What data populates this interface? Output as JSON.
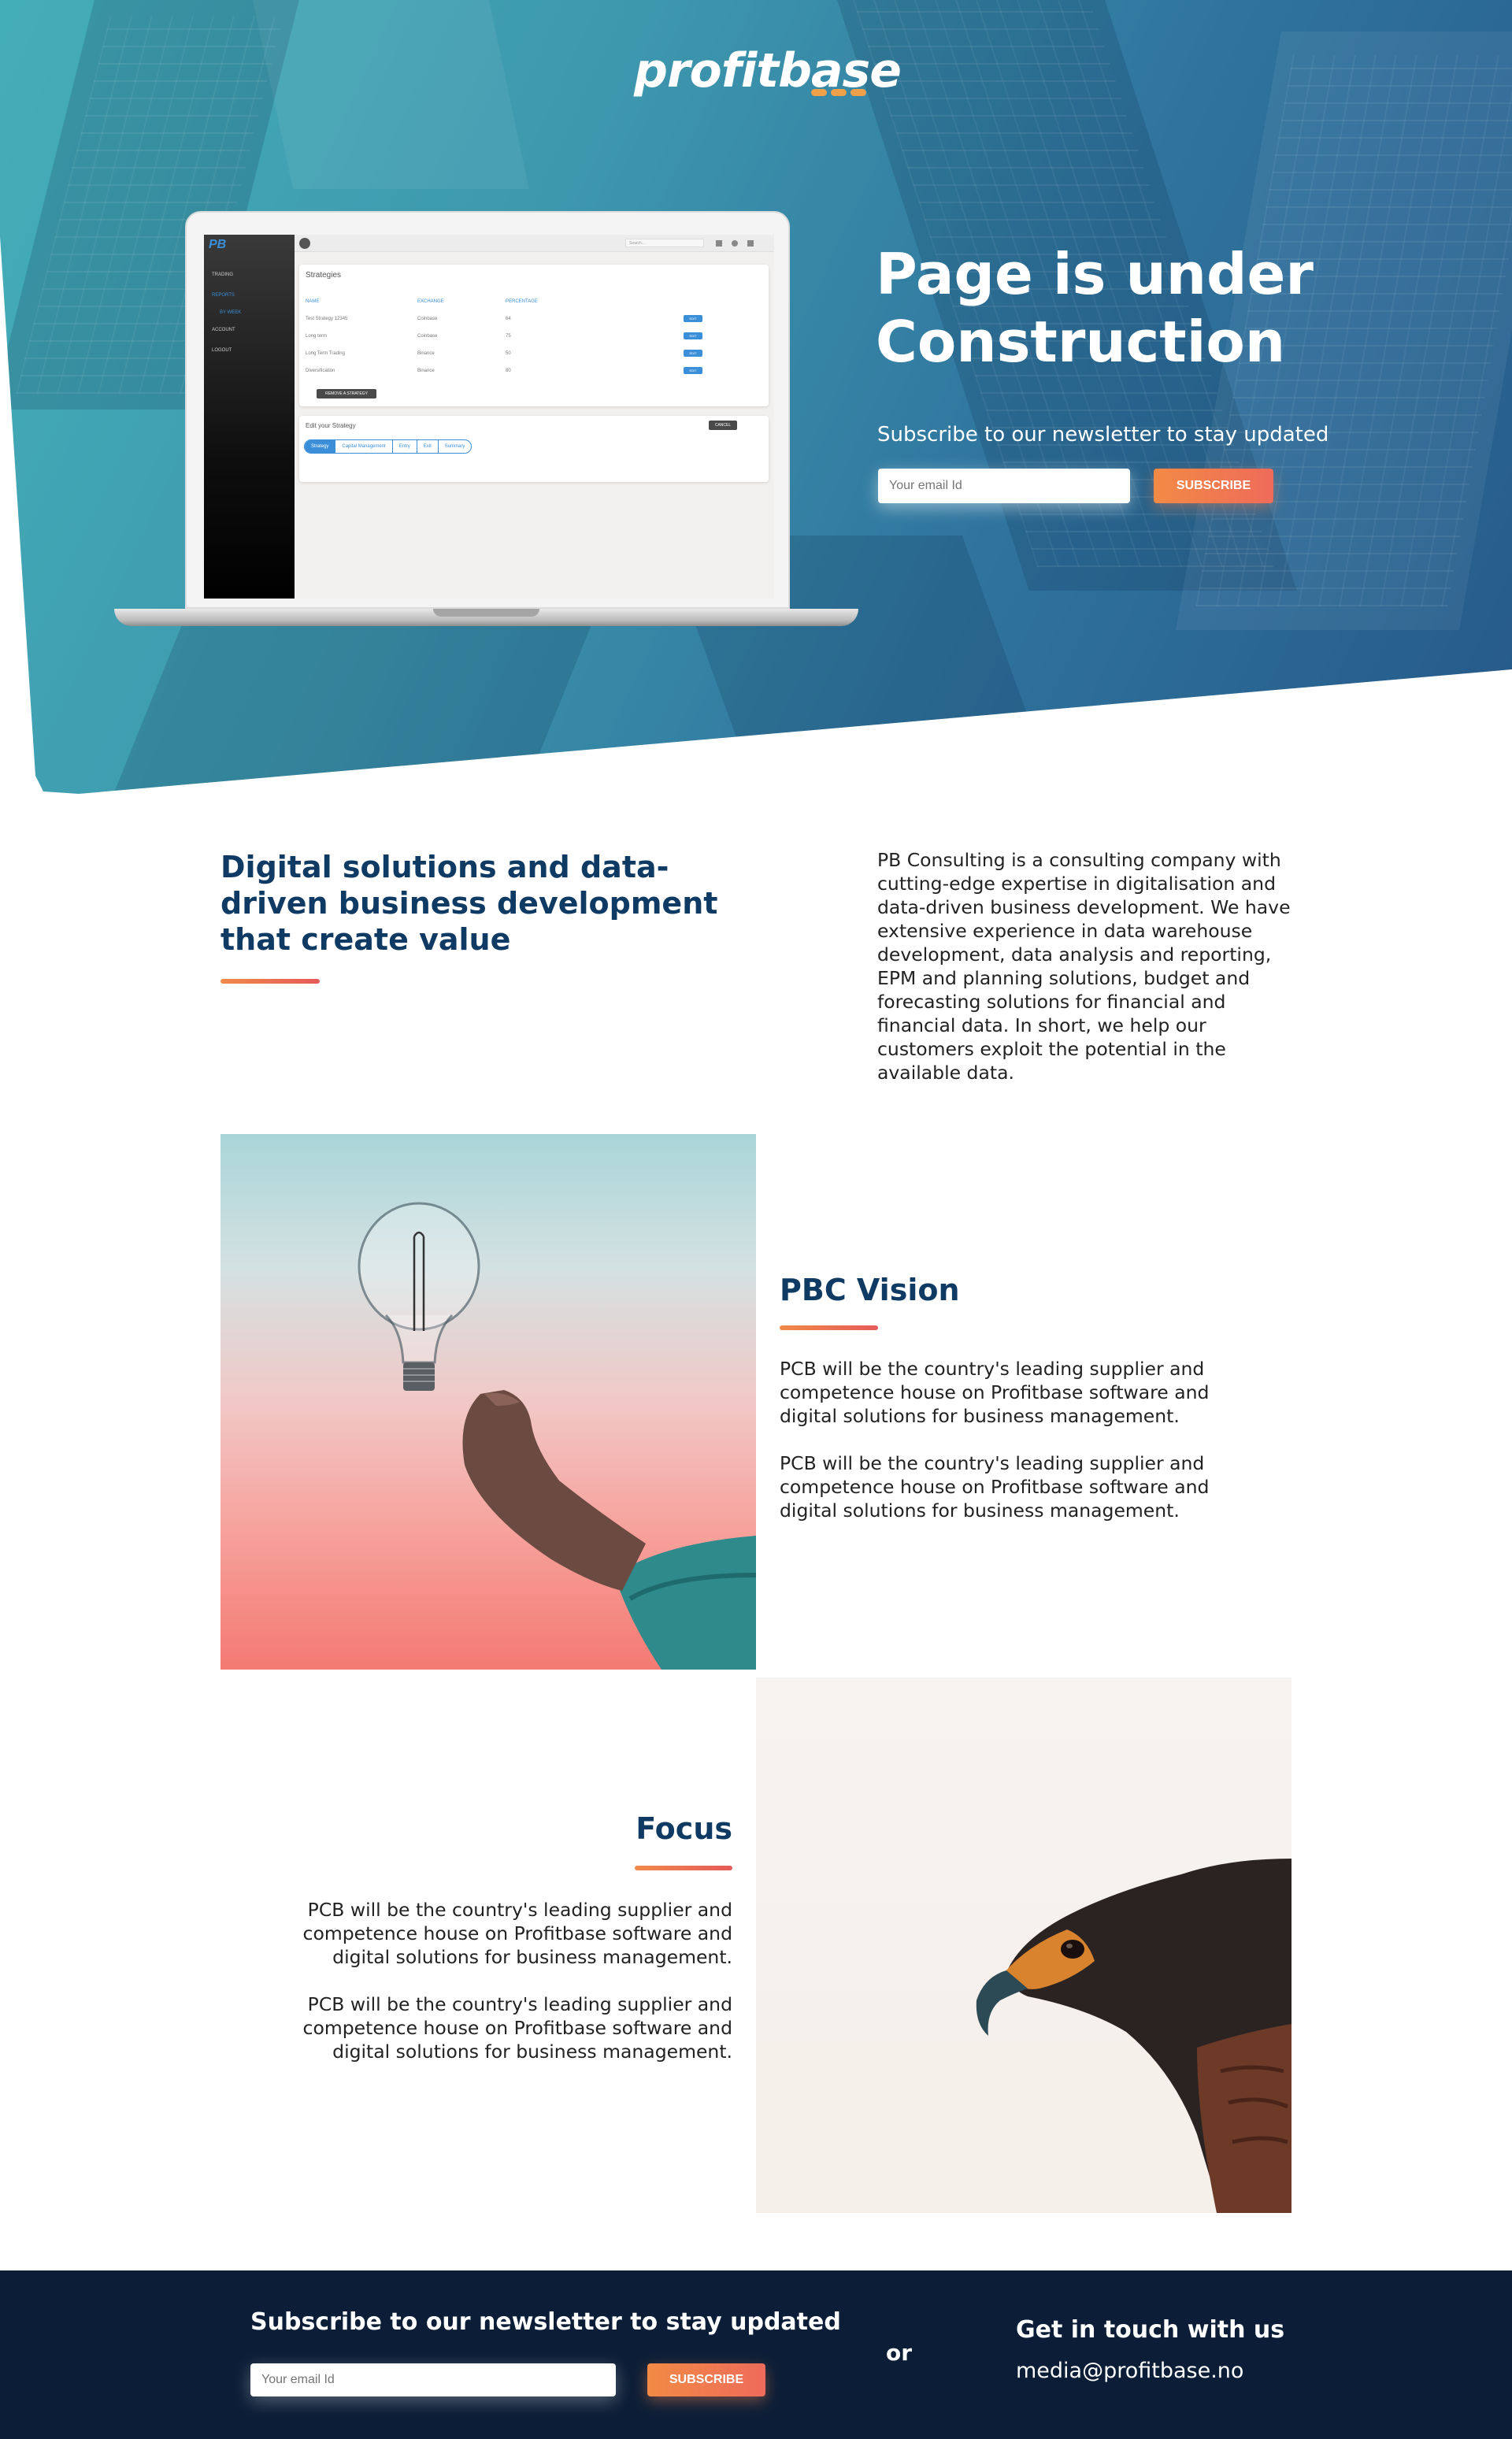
{
  "brand": {
    "logo_text": "profitbase",
    "accent_color": "#f0a04a",
    "primary_dark": "#0f3a63"
  },
  "hero": {
    "title": "Page is under Construction",
    "subtitle": "Subscribe to our newsletter to stay updated",
    "email_placeholder": "Your email Id",
    "subscribe_label": "SUBSCRIBE"
  },
  "laptop_screen": {
    "brand": "PB",
    "nav": [
      "TRADING",
      "REPORTS",
      "BY WEEK",
      "ACCOUNT",
      "LOGOUT"
    ],
    "search_placeholder": "Search...",
    "strategies_title": "Strategies",
    "table_headers": [
      "NAME",
      "EXCHANGE",
      "PERCENTAGE"
    ],
    "rows": [
      {
        "name": "Test Strategy 12345",
        "exchange": "Coinbase",
        "pct": "64"
      },
      {
        "name": "Long term",
        "exchange": "Coinbase",
        "pct": "75"
      },
      {
        "name": "Long Term Trading",
        "exchange": "Binance",
        "pct": "50"
      },
      {
        "name": "Diversification",
        "exchange": "Binance",
        "pct": "80"
      }
    ],
    "edit_label": "EDIT",
    "remove_label": "REMOVE A STRATEGY",
    "edit_title": "Edit your Strategy",
    "cancel_label": "CANCEL",
    "tabs": [
      "Strategy",
      "Capital Management",
      "Entry",
      "Exit",
      "Summary"
    ]
  },
  "intro": {
    "heading": "Digital solutions and data-driven business development that create value",
    "body": "PB Consulting is a consulting company with cutting-edge expertise in digitalisation and data-driven business development. We have extensive experience in data warehouse development, data analysis and reporting, EPM and planning solutions, budget and forecasting solutions for financial and financial data. In short, we help our customers exploit the potential in the available data."
  },
  "vision": {
    "title": "PBC Vision",
    "p1": "PCB will be the country's leading supplier and competence house on Profitbase software and digital solutions for business management.",
    "p2": "PCB will be the country's leading supplier and competence house on Profitbase software and digital solutions for business management."
  },
  "focus": {
    "title": "Focus",
    "p1": "PCB will be the country's leading supplier and competence house on Profitbase software and digital solutions for business management.",
    "p2": "PCB will be the country's leading supplier and competence house on Profitbase software and digital solutions for business management."
  },
  "footer": {
    "newsletter_title": "Subscribe to our newsletter to stay updated",
    "email_placeholder": "Your email Id",
    "subscribe_label": "SUBSCRIBE",
    "or_label": "or",
    "contact_title": "Get in touch with us",
    "contact_email": "media@profitbase.no"
  }
}
